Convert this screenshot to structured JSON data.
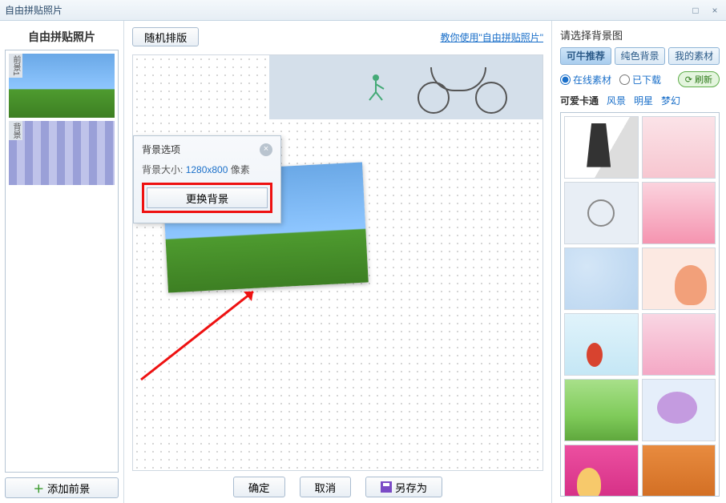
{
  "titlebar": {
    "title": "自由拼贴照片"
  },
  "left": {
    "title": "自由拼贴照片",
    "thumbs": [
      {
        "tag": "前景1"
      },
      {
        "tag": "背景"
      }
    ],
    "add_btn": "添加前景"
  },
  "center": {
    "random_btn": "随机排版",
    "help_link": "教你使用\"自由拼贴照片\"",
    "ok_btn": "确定",
    "cancel_btn": "取消",
    "saveas_btn": "另存为"
  },
  "popup": {
    "title": "背景选项",
    "size_label": "背景大小:",
    "size_value": "1280x800",
    "size_unit": "像素",
    "change_btn": "更换背景"
  },
  "right": {
    "title": "请选择背景图",
    "tabs": [
      "可牛推荐",
      "纯色背景",
      "我的素材"
    ],
    "radios": {
      "online": "在线素材",
      "downloaded": "已下载"
    },
    "refresh": "刷新",
    "categories": [
      "可爱卡通",
      "风景",
      "明星",
      "梦幻"
    ]
  }
}
